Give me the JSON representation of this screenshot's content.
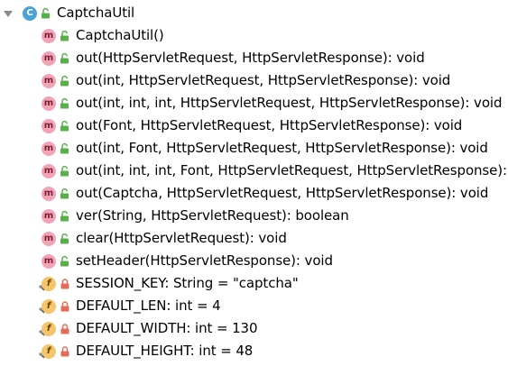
{
  "tree": {
    "class": {
      "name": "CaptchaUtil",
      "icon": "class-icon",
      "icon_letter": "C",
      "expanded": true
    },
    "members": [
      {
        "kind": "method",
        "visibility": "public",
        "icon_letter": "m",
        "label": "CaptchaUtil()"
      },
      {
        "kind": "method",
        "visibility": "public",
        "icon_letter": "m",
        "label": "out(HttpServletRequest, HttpServletResponse): void"
      },
      {
        "kind": "method",
        "visibility": "public",
        "icon_letter": "m",
        "label": "out(int, HttpServletRequest, HttpServletResponse): void"
      },
      {
        "kind": "method",
        "visibility": "public",
        "icon_letter": "m",
        "label": "out(int, int, int, HttpServletRequest, HttpServletResponse): void"
      },
      {
        "kind": "method",
        "visibility": "public",
        "icon_letter": "m",
        "label": "out(Font, HttpServletRequest, HttpServletResponse): void"
      },
      {
        "kind": "method",
        "visibility": "public",
        "icon_letter": "m",
        "label": "out(int, Font, HttpServletRequest, HttpServletResponse): void"
      },
      {
        "kind": "method",
        "visibility": "public",
        "icon_letter": "m",
        "label": "out(int, int, int, Font, HttpServletRequest, HttpServletResponse):"
      },
      {
        "kind": "method",
        "visibility": "public",
        "icon_letter": "m",
        "label": "out(Captcha, HttpServletRequest, HttpServletResponse): void"
      },
      {
        "kind": "method",
        "visibility": "public",
        "icon_letter": "m",
        "label": "ver(String, HttpServletRequest): boolean"
      },
      {
        "kind": "method",
        "visibility": "public",
        "icon_letter": "m",
        "label": "clear(HttpServletRequest): void"
      },
      {
        "kind": "method",
        "visibility": "public",
        "icon_letter": "m",
        "label": "setHeader(HttpServletResponse): void"
      },
      {
        "kind": "field",
        "visibility": "private",
        "icon_letter": "f",
        "label": "SESSION_KEY: String = \"captcha\""
      },
      {
        "kind": "field",
        "visibility": "private",
        "icon_letter": "f",
        "label": "DEFAULT_LEN: int = 4"
      },
      {
        "kind": "field",
        "visibility": "private",
        "icon_letter": "f",
        "label": "DEFAULT_WIDTH: int = 130"
      },
      {
        "kind": "field",
        "visibility": "private",
        "icon_letter": "f",
        "label": "DEFAULT_HEIGHT: int = 48"
      }
    ]
  },
  "colors": {
    "class_icon": "#4aa3d8",
    "method_icon": "#f3a3b6",
    "field_icon": "#f4c56a",
    "public_vis": "#58b04b",
    "private_vis": "#e06c5a"
  }
}
